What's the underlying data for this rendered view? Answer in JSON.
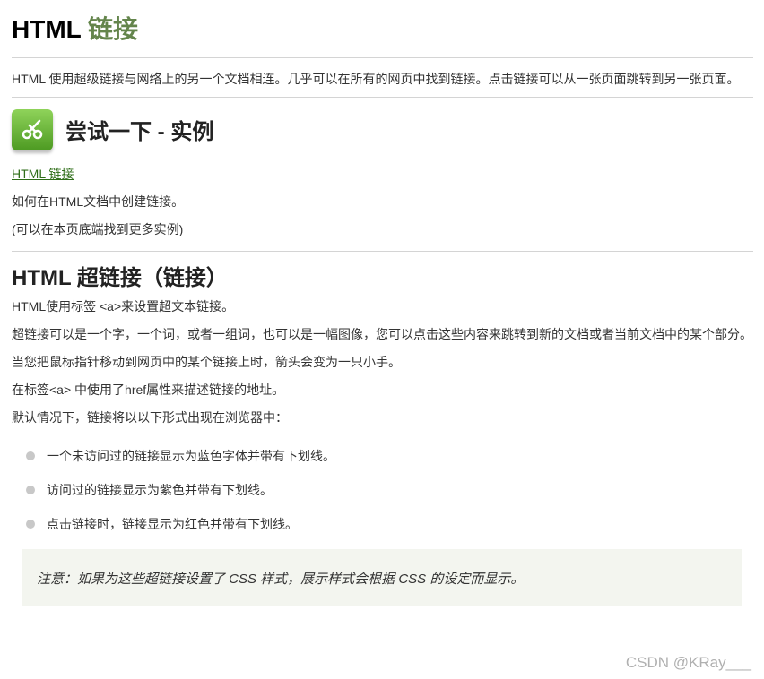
{
  "title": {
    "prefix": "HTML",
    "accent": "链接"
  },
  "intro": "HTML 使用超级链接与网络上的另一个文档相连。几乎可以在所有的网页中找到链接。点击链接可以从一张页面跳转到另一张页面。",
  "tryit": {
    "icon": "scissors-icon",
    "heading": "尝试一下 - 实例",
    "link_label": "HTML 链接",
    "desc": "如何在HTML文档中创建链接。",
    "more": "(可以在本页底端找到更多实例)"
  },
  "section": {
    "heading": "HTML 超链接（链接）",
    "paragraphs": [
      "HTML使用标签 <a>来设置超文本链接。",
      "超链接可以是一个字，一个词，或者一组词，也可以是一幅图像，您可以点击这些内容来跳转到新的文档或者当前文档中的某个部分。",
      "当您把鼠标指针移动到网页中的某个链接上时，箭头会变为一只小手。",
      "在标签<a> 中使用了href属性来描述链接的地址。",
      "默认情况下，链接将以以下形式出现在浏览器中："
    ],
    "bullets": [
      "一个未访问过的链接显示为蓝色字体并带有下划线。",
      "访问过的链接显示为紫色并带有下划线。",
      "点击链接时，链接显示为红色并带有下划线。"
    ],
    "note": "注意：如果为这些超链接设置了 CSS 样式，展示样式会根据 CSS 的设定而显示。"
  },
  "watermark": "CSDN @KRay___",
  "colors": {
    "accent": "#64854c",
    "link": "#2f6e18",
    "note_bg": "#f3f5ef"
  }
}
